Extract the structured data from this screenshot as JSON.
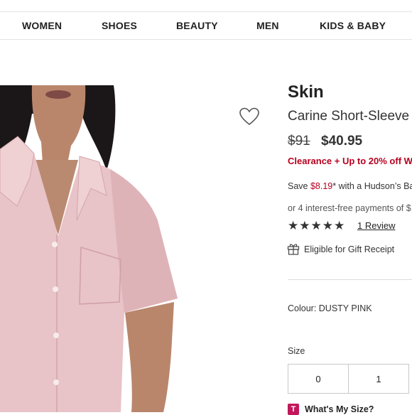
{
  "nav": {
    "items": [
      "WOMEN",
      "SHOES",
      "BEAUTY",
      "MEN",
      "KIDS & BABY"
    ]
  },
  "product": {
    "brand": "Skin",
    "name": "Carine Short-Sleeve",
    "price_original": "$91",
    "price_sale": "$40.95",
    "promo": "Clearance + Up to 20% off Wit",
    "save_prefix": "Save ",
    "save_amount": "$8.19",
    "save_suffix": "* with a Hudson’s Ba",
    "installments": "or 4 interest-free payments of $",
    "rating": 5,
    "rating_max": 5,
    "review_link": "1 Review",
    "gift_receipt": "Eligible for Gift Receipt",
    "colour_label": "Colour:",
    "colour_value": "DUSTY PINK",
    "size_label": "Size",
    "sizes": [
      "0",
      "1"
    ],
    "fit_link": "What's My Size?",
    "fit_icon_letter": "T"
  },
  "icons": {
    "wishlist": "heart-outline-icon",
    "gift": "gift-icon",
    "star": "star-filled-icon"
  },
  "colors": {
    "sale_red": "#b8001f",
    "fit_badge": "#c2185b",
    "shirt_pink": "#e8c3c7"
  }
}
